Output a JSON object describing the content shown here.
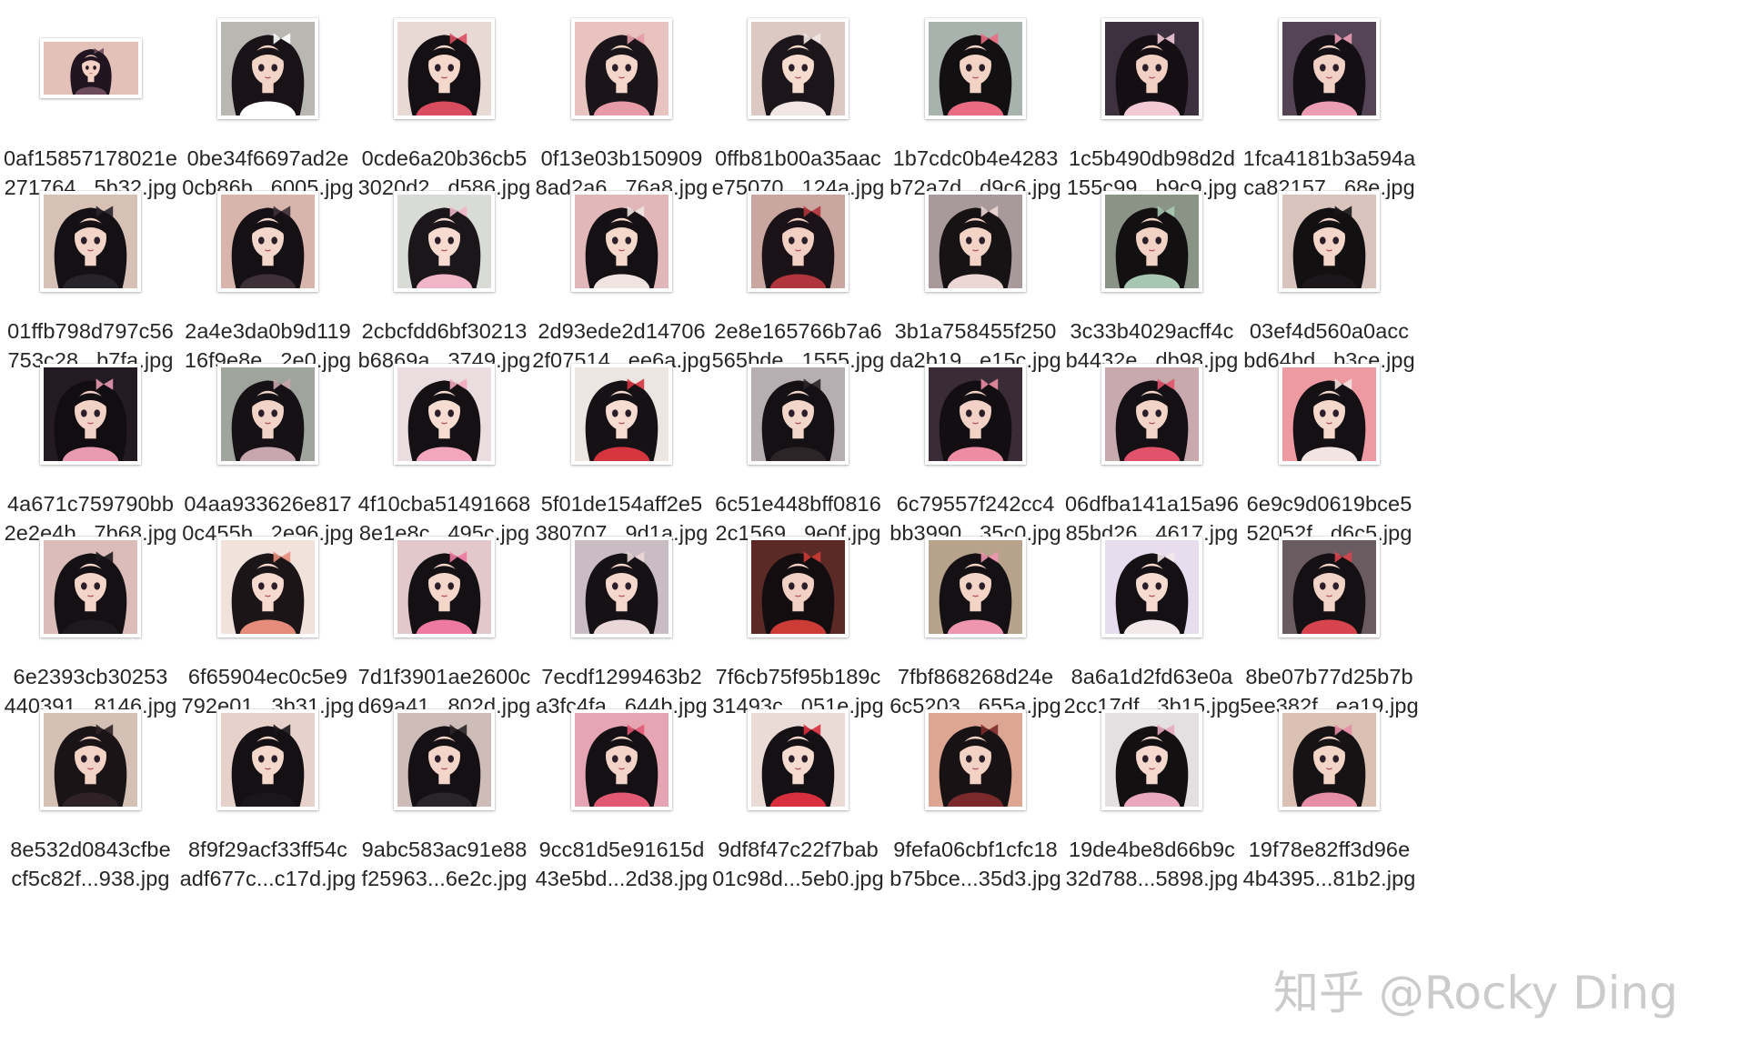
{
  "files": [
    {
      "line1": "0af15857178021e",
      "line2": "271764...5b32.jpg",
      "bg": "#e3c1b8",
      "hair": "#1f1420",
      "skin": "#f3d2c5",
      "accent": "#6b4b5a",
      "orientation": "landscape"
    },
    {
      "line1": "0be34f6697ad2e",
      "line2": "0cb86b...6005.jpg",
      "bg": "#b9b7b2",
      "hair": "#191317",
      "skin": "#f3d5c8",
      "accent": "#ffffff",
      "orientation": "square"
    },
    {
      "line1": "0cde6a20b36cb5",
      "line2": "3020d2...d586.jpg",
      "bg": "#e9d9d4",
      "hair": "#141013",
      "skin": "#f5d8cc",
      "accent": "#d94b5f",
      "orientation": "square"
    },
    {
      "line1": "0f13e03b150909",
      "line2": "8ad2a6...76a8.jpg",
      "bg": "#e8c3c0",
      "hair": "#1b1418",
      "skin": "#f4d6ca",
      "accent": "#e79aa8",
      "orientation": "square"
    },
    {
      "line1": "0ffb81b00a35aac",
      "line2": "e75070...124a.jpg",
      "bg": "#dcc9c3",
      "hair": "#1c1519",
      "skin": "#f6dccf",
      "accent": "#f2e7e4",
      "orientation": "square"
    },
    {
      "line1": "1b7cdc0b4e4283",
      "line2": "b72a7d...d9c6.jpg",
      "bg": "#a9b3ad",
      "hair": "#131012",
      "skin": "#f2d3c6",
      "accent": "#e96c82",
      "orientation": "square"
    },
    {
      "line1": "1c5b490db98d2d",
      "line2": "155c99...b9c9.jpg",
      "bg": "#3d3140",
      "hair": "#150f14",
      "skin": "#f2d0c4",
      "accent": "#f2c9d5",
      "orientation": "square"
    },
    {
      "line1": "1fca4181b3a594a",
      "line2": "ca82157...68e.jpg",
      "bg": "#544456",
      "hair": "#130f14",
      "skin": "#f1d1c5",
      "accent": "#ec9cb3",
      "orientation": "square"
    },
    {
      "line1": "01ffb798d797c56",
      "line2": "753c28...b7fa.jpg",
      "bg": "#d7c1b6",
      "hair": "#141013",
      "skin": "#f2d4c8",
      "accent": "#27232b",
      "orientation": "square"
    },
    {
      "line1": "2a4e3da0b9d119",
      "line2": "16f9e8e...2e0.jpg",
      "bg": "#d8b5ac",
      "hair": "#151013",
      "skin": "#f3d6cb",
      "accent": "#3d3036",
      "orientation": "square"
    },
    {
      "line1": "2cbcfdd6bf30213",
      "line2": "b6869a...3749.jpg",
      "bg": "#d9dbd6",
      "hair": "#1b161a",
      "skin": "#f7dbd0",
      "accent": "#f0b5c7",
      "orientation": "square"
    },
    {
      "line1": "2d93ede2d14706",
      "line2": "2f07514...ee6a.jpg",
      "bg": "#e2b7b9",
      "hair": "#141013",
      "skin": "#f4d8cc",
      "accent": "#efe4e0",
      "orientation": "square"
    },
    {
      "line1": "2e8e165766b7a6",
      "line2": "565bde...1555.jpg",
      "bg": "#caa6a1",
      "hair": "#1a1216",
      "skin": "#f1d0c3",
      "accent": "#b0353c",
      "orientation": "square"
    },
    {
      "line1": "3b1a758455f250",
      "line2": "da2b19...e15c.jpg",
      "bg": "#a89a9a",
      "hair": "#171214",
      "skin": "#f2d3c6",
      "accent": "#ecd7d5",
      "orientation": "square"
    },
    {
      "line1": "3c33b4029acff4c",
      "line2": "b4432e...db98.jpg",
      "bg": "#8a9486",
      "hair": "#131012",
      "skin": "#f1d2c5",
      "accent": "#a7c7b2",
      "orientation": "square"
    },
    {
      "line1": "03ef4d560a0acc",
      "line2": "bd64bd...b3ce.jpg",
      "bg": "#d8c3bd",
      "hair": "#131012",
      "skin": "#f3d5c9",
      "accent": "#1b171a",
      "orientation": "square"
    },
    {
      "line1": "4a671c759790bb",
      "line2": "2e2e4b...7b68.jpg",
      "bg": "#241a22",
      "hair": "#120d11",
      "skin": "#f2d2c6",
      "accent": "#e89ab0",
      "orientation": "square"
    },
    {
      "line1": "04aa933626e817",
      "line2": "0c455b...2e96.jpg",
      "bg": "#9fa59c",
      "hair": "#151114",
      "skin": "#f1d3c7",
      "accent": "#c7a6ad",
      "orientation": "square"
    },
    {
      "line1": "4f10cba51491668",
      "line2": "8e1e8c...495c.jpg",
      "bg": "#e9dde0",
      "hair": "#141013",
      "skin": "#f6dcd1",
      "accent": "#f2a7bf",
      "orientation": "square"
    },
    {
      "line1": "5f01de154aff2e5",
      "line2": "380707...9d1a.jpg",
      "bg": "#ece6e2",
      "hair": "#161114",
      "skin": "#f6dcd1",
      "accent": "#d4353f",
      "orientation": "square"
    },
    {
      "line1": "6c51e448bff0816",
      "line2": "2c1569...9e0f.jpg",
      "bg": "#b7aeb1",
      "hair": "#141013",
      "skin": "#f3d6ca",
      "accent": "#2b2528",
      "orientation": "square"
    },
    {
      "line1": "6c79557f242cc4",
      "line2": "bb3990...35c0.jpg",
      "bg": "#3a2c36",
      "hair": "#130e12",
      "skin": "#f2d2c6",
      "accent": "#ee8ca4",
      "orientation": "square"
    },
    {
      "line1": "06dfba141a15a96",
      "line2": "85bd26...4617.jpg",
      "bg": "#c8a9ad",
      "hair": "#141013",
      "skin": "#f3d4c8",
      "accent": "#e2536b",
      "orientation": "square"
    },
    {
      "line1": "6e9c9d0619bce5",
      "line2": "52052f...d6c5.jpg",
      "bg": "#ee9aa2",
      "hair": "#141013",
      "skin": "#f5d8cc",
      "accent": "#f2e4e1",
      "orientation": "square"
    },
    {
      "line1": "6e2393cb30253",
      "line2": "440391...8146.jpg",
      "bg": "#dbbcb8",
      "hair": "#141013",
      "skin": "#f3d5c9",
      "accent": "#1d1a1d",
      "orientation": "square"
    },
    {
      "line1": "6f65904ec0c5e9",
      "line2": "792e01...3b31.jpg",
      "bg": "#f1e3dc",
      "hair": "#1b1518",
      "skin": "#f6dacf",
      "accent": "#e58c7a",
      "orientation": "square"
    },
    {
      "line1": "7d1f3901ae2600c",
      "line2": "d69a41...802d.jpg",
      "bg": "#e2c8ca",
      "hair": "#141013",
      "skin": "#f4d6ca",
      "accent": "#ee79a1",
      "orientation": "square"
    },
    {
      "line1": "7ecdf1299463b2",
      "line2": "a3fc4fa...644b.jpg",
      "bg": "#c9bdc3",
      "hair": "#161114",
      "skin": "#f5d8cd",
      "accent": "#ead7d7",
      "orientation": "square"
    },
    {
      "line1": "7f6cb75f95b189c",
      "line2": "31493c...051e.jpg",
      "bg": "#5b2a27",
      "hair": "#130d10",
      "skin": "#f2d1c4",
      "accent": "#cc3b35",
      "orientation": "square"
    },
    {
      "line1": "7fbf868268d24e",
      "line2": "6c5203...655a.jpg",
      "bg": "#b7a38c",
      "hair": "#141013",
      "skin": "#f3d4c7",
      "accent": "#ef95b0",
      "orientation": "square"
    },
    {
      "line1": "8a6a1d2fd63e0a",
      "line2": "2cc17df...3b15.jpg",
      "bg": "#e8dcef",
      "hair": "#141013",
      "skin": "#f6dbd0",
      "accent": "#f3e8ea",
      "orientation": "square"
    },
    {
      "line1": "8be07b77d25b7b",
      "line2": "5ee382f...ea19.jpg",
      "bg": "#6a5b60",
      "hair": "#151013",
      "skin": "#f2d3c7",
      "accent": "#d8444e",
      "orientation": "square"
    },
    {
      "line1": "8e532d0843cfbe",
      "line2": "cf5c82f...938.jpg",
      "bg": "#d4c0b5",
      "hair": "#1a1416",
      "skin": "#f2d3c6",
      "accent": "#2e2226",
      "orientation": "square"
    },
    {
      "line1": "8f9f29acf33ff54c",
      "line2": "adf677c...c17d.jpg",
      "bg": "#e7d2cb",
      "hair": "#141013",
      "skin": "#f5d8cc",
      "accent": "#1a1619",
      "orientation": "square"
    },
    {
      "line1": "9abc583ac91e88",
      "line2": "f25963...6e2c.jpg",
      "bg": "#cdbcb8",
      "hair": "#141013",
      "skin": "#f3d5c9",
      "accent": "#2a2528",
      "orientation": "square"
    },
    {
      "line1": "9cc81d5e91615d",
      "line2": "43e5bd...2d38.jpg",
      "bg": "#e6a5b3",
      "hair": "#141013",
      "skin": "#f4d4c8",
      "accent": "#e25974",
      "orientation": "square"
    },
    {
      "line1": "9df8f47c22f7bab",
      "line2": "01c98d...5eb0.jpg",
      "bg": "#ebdbd7",
      "hair": "#141013",
      "skin": "#f6dbd0",
      "accent": "#d82f3e",
      "orientation": "square"
    },
    {
      "line1": "9fefa06cbf1cfc18",
      "line2": "b75bce...35d3.jpg",
      "bg": "#dca692",
      "hair": "#181214",
      "skin": "#f2d2c4",
      "accent": "#7b2a2b",
      "orientation": "square"
    },
    {
      "line1": "19de4be8d66b9c",
      "line2": "32d788...5898.jpg",
      "bg": "#e4e0e2",
      "hair": "#131012",
      "skin": "#f5d9ce",
      "accent": "#e9a8bd",
      "orientation": "square"
    },
    {
      "line1": "19f78e82ff3d96e",
      "line2": "4b4395...81b2.jpg",
      "bg": "#dbc1b4",
      "hair": "#171214",
      "skin": "#f3d5c8",
      "accent": "#e58ea6",
      "orientation": "square"
    }
  ],
  "watermark": "知乎 @Rocky Ding"
}
